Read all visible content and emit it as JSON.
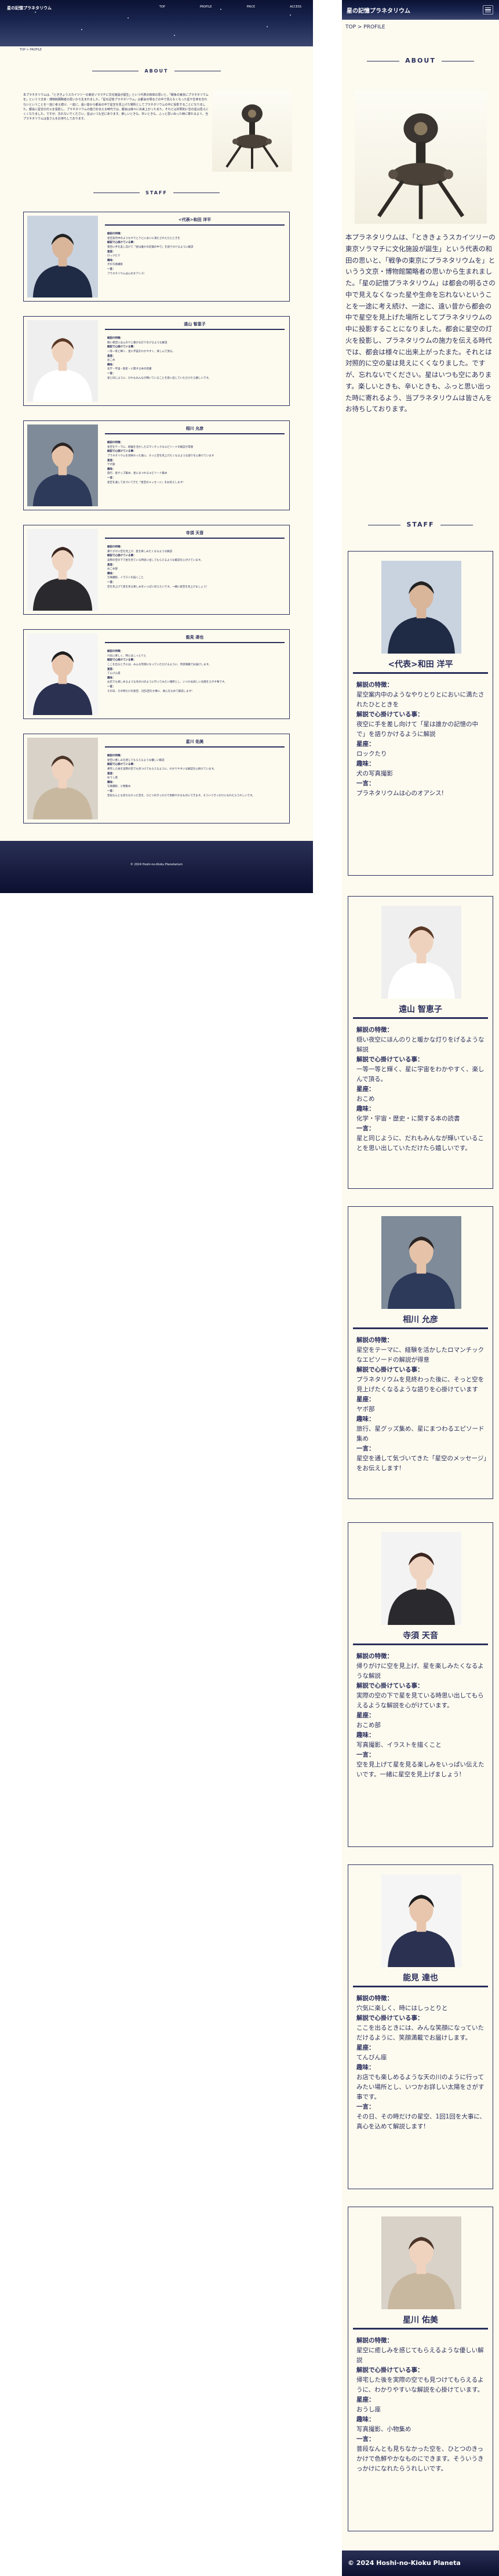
{
  "desktop": {
    "logo": "星の記憶プラネタリウム",
    "nav": [
      "TOP",
      "PROFILE",
      "PRICE",
      "ACCESS"
    ],
    "breadcrumb": "TOP > PROFILE",
    "about_heading": "ABOUT",
    "staff_heading": "STAFF",
    "copyright": "© 2024 Hoshi-no-Kioku Planetarium"
  },
  "mobile": {
    "logo": "星の記憶プラネタリウム",
    "breadcrumb": "TOP > PROFILE",
    "about_heading": "ABOUT",
    "staff_heading": "STAFF",
    "copyright": "© 2024 Hoshi-no-Kioku Planeta"
  },
  "about_text": "本プラネタリウムは、「とききょうスカイツリーの東京ソラマチに文化施設が誕生」という代表の和田の思いと、「戦争の東京にプラネタリウムを」というう文京・博物館閣略者の思いから生まれました。「星の記憶プラネタリウム」は都会の明るさの中で見えなくなった星や生命を忘れないということを一途に考え続け、一途に、遠い昔から都会の中で星空を見上げた場所としてプラネタリウムの中に投影することになりました。都会に星空の灯火を投影し、プラネタリウムの施力を伝える時代では、都会は様々に出来上がったまた。それとは対照的に空の星は見えにくくなりました。ですが、忘れないでください。星はいつも空にあります。楽しいときも、辛いときも、ふっと思い出った時に寄れるよう、当プラネタリウムは皆さんをお待ちしております。",
  "staff": [
    {
      "name": "<代表>和田 洋平",
      "desc": "星空案内中のようなやりとりとにおいに満たされたひとときを",
      "pos": "夜空に手を差し向けて「星は誰かの記憶の中で」を語りかけるように解説",
      "hobby": "ロックたり",
      "skill": "犬の写真撮影",
      "word": "プラネタリウムは心のオアシス!"
    },
    {
      "name": "遠山 智恵子",
      "desc": "穏い夜空にほんのりと暖かな灯りをげるような解説",
      "pos": "一等一等と輝く、星に宇宙をわかやすく、楽しんで頂る。",
      "hobby": "おこめ",
      "skill": "化学・宇宙・歴史・に関する本の読書",
      "word": "星と同じように、だれもみんなが輝いていることを思い出していただけたら嬉しいです。"
    },
    {
      "name": "相川 允彦",
      "desc": "星空をテーマに、経験を活かしたロマンチックなエピソードの解説が得意",
      "pos": "プラネタリウムを見終わった後に、そっと空を見上げたくなるような語りを心掛けています",
      "hobby": "ヤボ部",
      "skill": "旅行、星グッズ集め、星にまつわるエピソード集め",
      "word": "星空を通して気づいてきた「星空のメッセージ」をお伝えします!"
    },
    {
      "name": "寺須 天音",
      "desc": "帰りがけに空を見上げ、星を楽しみたくなるような解説",
      "pos": "実際の空の下で星を見ている時思い出してもらえるような解説を心がけています。",
      "hobby": "おこめ部",
      "skill": "写真撮影、イラストを描くこと",
      "word": "空を見上げて星を見る楽しみをいっぱい伝えたいです。一緒に星空を見上げましょう!"
    },
    {
      "name": "能見 達也",
      "desc": "穴気に楽しく、時にはしっとりと",
      "pos": "ここを出るときには、みんな笑顔になっていただけるように、笑顔満載でお届けします。",
      "hobby": "てんびん座",
      "skill": "お店でも楽しめるような天の川のように行ってみたい場所とし、いつかお詳しい太陽をさがす事です。",
      "word": "その日、その時だけの星空、1回1回を大事に、真心を込めて解説します!"
    },
    {
      "name": "星川 佑美",
      "desc": "星空に癒しみを感じてもらえるような優しい解説",
      "pos": "帰宅した後を実際の空でも見つけてもらえるように、わかりやすいな解説を心掛けています。",
      "hobby": "おうし座",
      "skill": "写真撮影、小物集め",
      "word": "普段なんとも見ちなかった空を、ひとつのきっかけで色鮮やかなものにできます。そういうきっかけになれたらうれしいです。"
    }
  ],
  "labels": {
    "desc": "解説の特徴：",
    "pos": "解説で心掛けている事：",
    "hobby": "星座：",
    "skill": "趣味：",
    "word": "一言："
  }
}
